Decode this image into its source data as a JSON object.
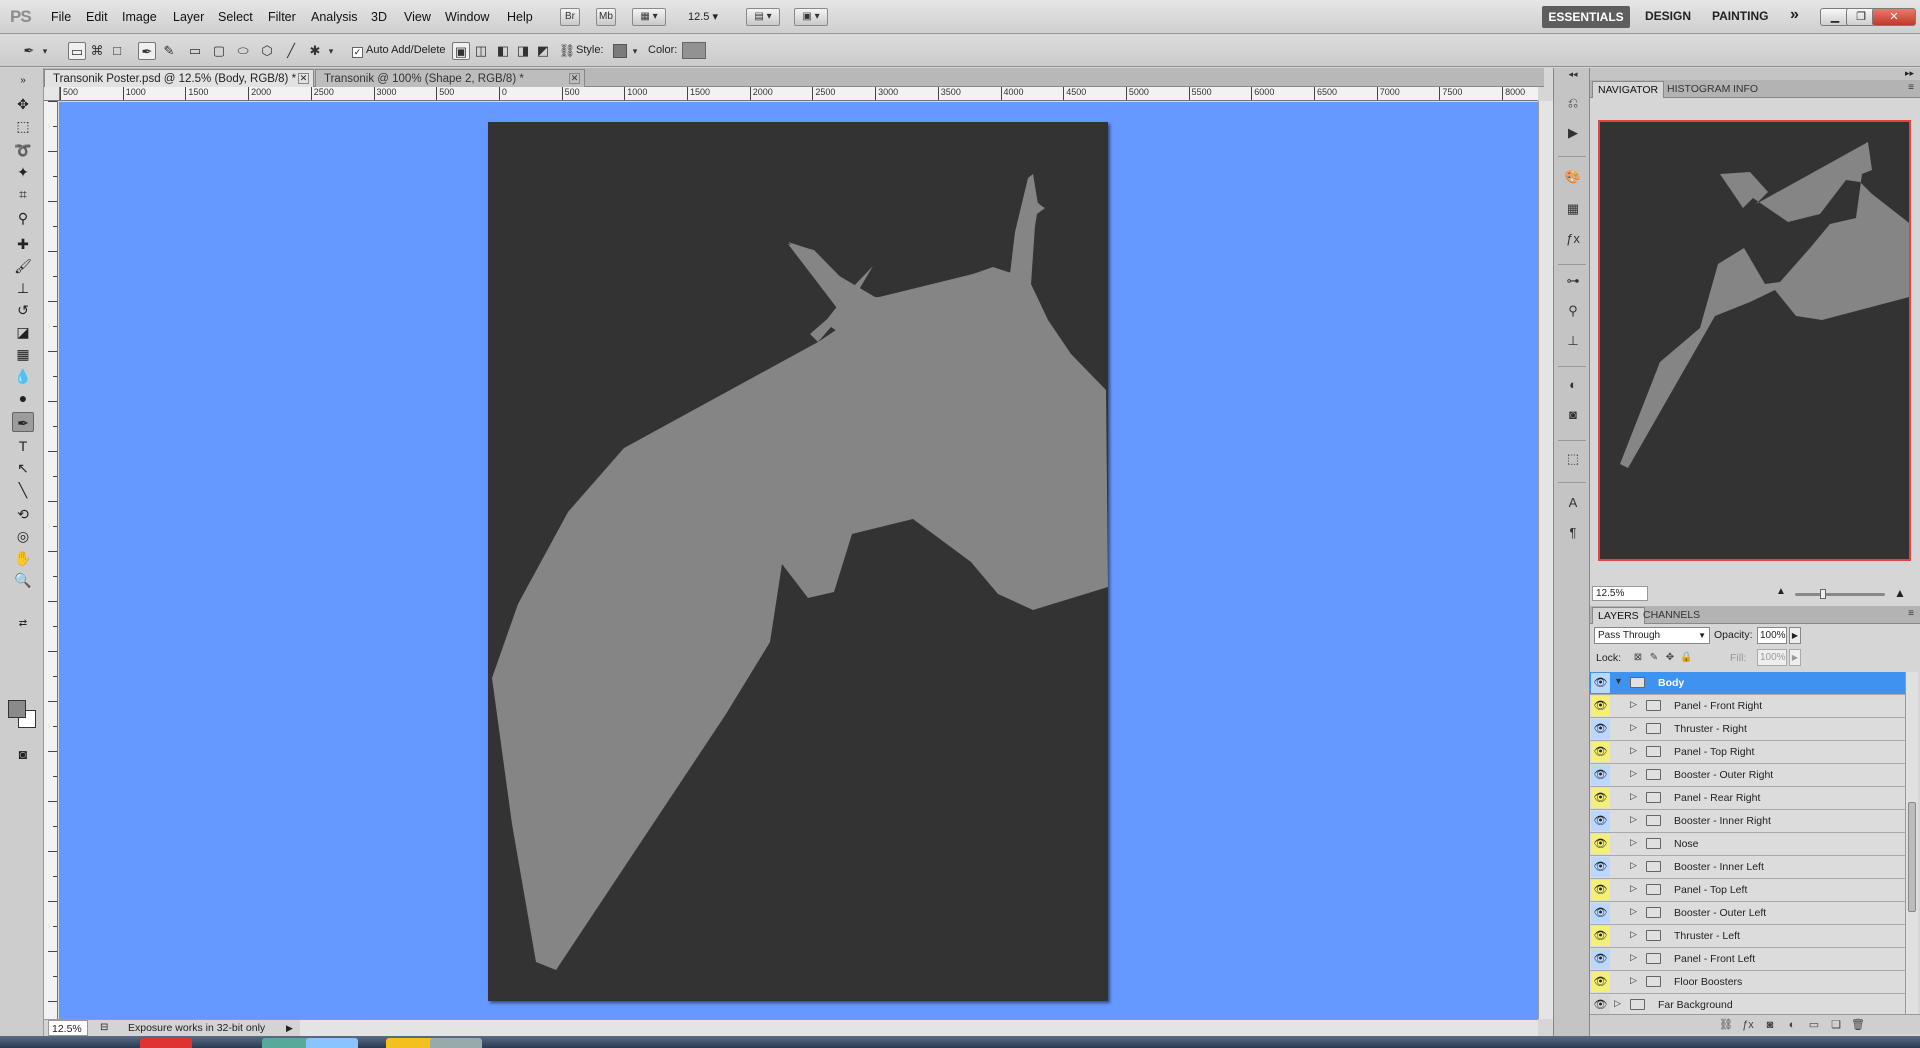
{
  "app": {
    "logo": "PS",
    "menu": [
      "File",
      "Edit",
      "Image",
      "Layer",
      "Select",
      "Filter",
      "Analysis",
      "3D",
      "View",
      "Window",
      "Help"
    ],
    "bridge_label": "Br",
    "minibridge_label": "Mb",
    "zoom_value": "12.5",
    "workspaces": [
      "ESSENTIALS",
      "DESIGN",
      "PAINTING"
    ],
    "workspaces_more": "»"
  },
  "options": {
    "auto_add_delete": "Auto Add/Delete",
    "auto_add_checked": "✓",
    "style_label": "Style:",
    "color_label": "Color:"
  },
  "tabs": [
    {
      "title": "Transonik Poster.psd @ 12.5% (Body, RGB/8) *",
      "close": "✕"
    },
    {
      "title": "Transonik @ 100% (Shape 2, RGB/8) *",
      "close": "✕"
    }
  ],
  "ruler": {
    "h_labels": [
      "500",
      "1000",
      "1500",
      "2000",
      "2500",
      "3000",
      "500",
      "0",
      "500",
      "1000",
      "1500",
      "2000",
      "2500",
      "3000",
      "3500",
      "4000",
      "4500",
      "5000",
      "5500",
      "6000",
      "6500",
      "7000",
      "7500",
      "8000"
    ]
  },
  "status": {
    "zoom": "12.5%",
    "info": "Exposure works in 32-bit only",
    "arrow": "▶"
  },
  "navigator": {
    "tabs": [
      "NAVIGATOR",
      "HISTOGRAM",
      "INFO"
    ],
    "zoom": "12.5%",
    "small_icon": "▲",
    "big_icon": "▲"
  },
  "layers": {
    "tabs": [
      "LAYERS",
      "CHANNELS"
    ],
    "blend_mode": "Pass Through",
    "opacity_label": "Opacity:",
    "opacity": "100%",
    "lock_label": "Lock:",
    "fill_label": "Fill:",
    "fill": "100%",
    "items": [
      {
        "name": "Body",
        "level": 0,
        "expanded": true,
        "selected": true,
        "eye_color": "#b9d7ff"
      },
      {
        "name": "Panel - Front Right",
        "level": 1,
        "eye_color": "#f4f077"
      },
      {
        "name": "Thruster - Right",
        "level": 1,
        "eye_color": "#b9d7ff"
      },
      {
        "name": "Panel - Top Right",
        "level": 1,
        "eye_color": "#f4f077"
      },
      {
        "name": "Booster - Outer Right",
        "level": 1,
        "eye_color": "#b9d7ff"
      },
      {
        "name": "Panel - Rear Right",
        "level": 1,
        "eye_color": "#f4f077"
      },
      {
        "name": "Booster - Inner Right",
        "level": 1,
        "eye_color": "#b9d7ff"
      },
      {
        "name": "Nose",
        "level": 1,
        "eye_color": "#f4f077"
      },
      {
        "name": "Booster - Inner Left",
        "level": 1,
        "eye_color": "#b9d7ff"
      },
      {
        "name": "Panel - Top Left",
        "level": 1,
        "eye_color": "#f4f077"
      },
      {
        "name": "Booster - Outer Left",
        "level": 1,
        "eye_color": "#b9d7ff"
      },
      {
        "name": "Thruster - Left",
        "level": 1,
        "eye_color": "#f4f077"
      },
      {
        "name": "Panel - Front Left",
        "level": 1,
        "eye_color": "#b9d7ff"
      },
      {
        "name": "Floor Boosters",
        "level": 1,
        "eye_color": "#f4f077"
      },
      {
        "name": "Far Background",
        "level": 0,
        "eye_color": "#d6d6d6"
      }
    ]
  },
  "colors": {
    "canvas_bg": "#6699ff",
    "document_bg": "#333333",
    "shape_fill": "#858585",
    "selection": "#3e92f0"
  }
}
